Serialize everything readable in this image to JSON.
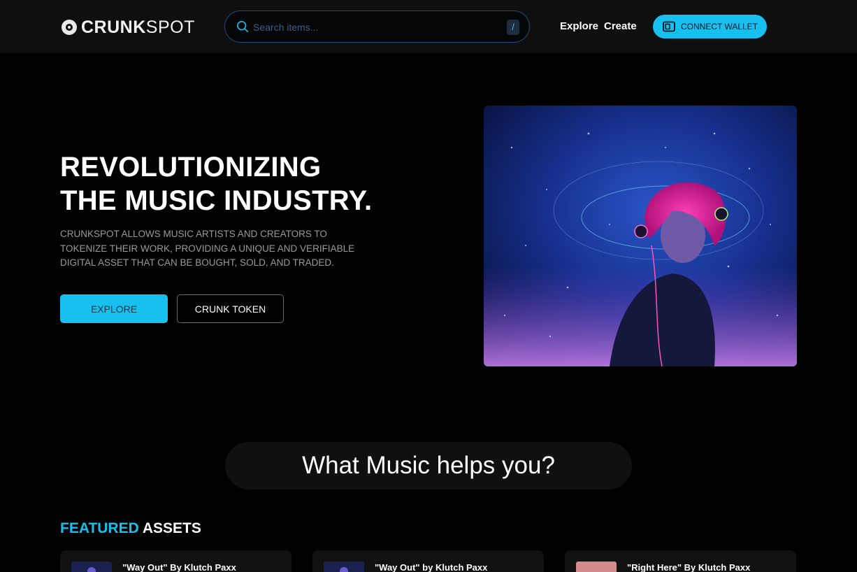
{
  "header": {
    "logo": {
      "strong": "CRUNK",
      "light": "SPOT"
    },
    "search": {
      "placeholder": "Search items...",
      "shortcut": "/"
    },
    "nav": {
      "explore": "Explore",
      "create": "Create"
    },
    "connect_wallet": "CONNECT WALLET"
  },
  "hero": {
    "title_line1": "REVOLUTIONIZING",
    "title_line2": "THE MUSIC INDUSTRY.",
    "description": "CRUNKSPOT ALLOWS MUSIC ARTISTS AND CREATORS TO TOKENIZE THEIR WORK, PROVIDING A UNIQUE AND VERIFIABLE DIGITAL ASSET THAT CAN BE BOUGHT, SOLD, AND TRADED.",
    "explore_button": "EXPLORE",
    "token_button": "CRUNK TOKEN"
  },
  "section": {
    "title": "What Music helps you?"
  },
  "featured": {
    "accent": "FEATURED",
    "rest": " ASSETS",
    "cards": [
      {
        "title": "\"Way Out\" By Klutch Paxx"
      },
      {
        "title": "\"Way Out\" by Klutch Paxx"
      },
      {
        "title": "\"Right Here\" By Klutch Paxx"
      }
    ]
  },
  "colors": {
    "accent": "#17c0ee",
    "background": "#000000",
    "header": "#0f0f10"
  }
}
